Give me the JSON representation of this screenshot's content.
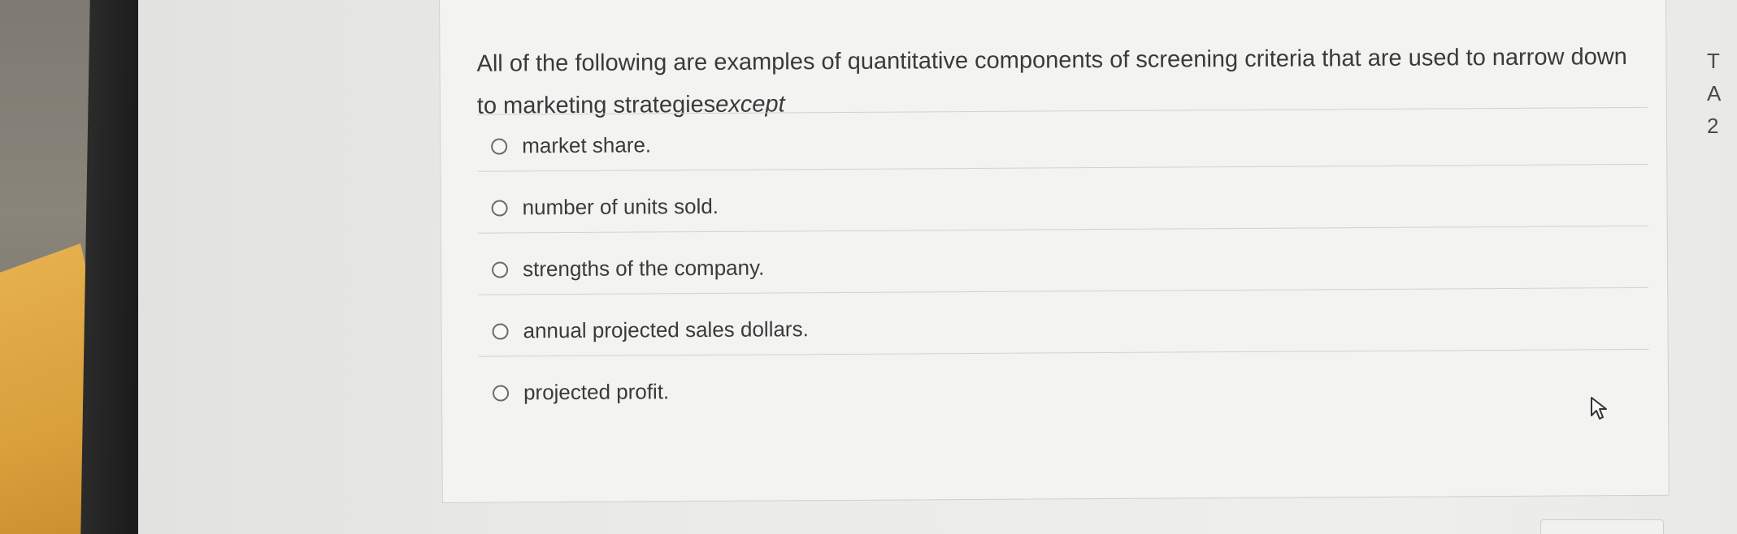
{
  "question": {
    "text": "All of the following are examples of quantitative components of screening criteria that are used to narrow down to marketing strategies",
    "emphasis": "except"
  },
  "options": [
    {
      "label": "market share."
    },
    {
      "label": "number of units sold."
    },
    {
      "label": "strengths of the company."
    },
    {
      "label": "annual projected sales dollars."
    },
    {
      "label": "projected profit."
    }
  ],
  "right_panel": {
    "line1": "T",
    "line2": "A",
    "line3": "2"
  },
  "icons": {
    "cursor": "pointer-arrow-icon",
    "radio": "radio-unselected-icon"
  }
}
